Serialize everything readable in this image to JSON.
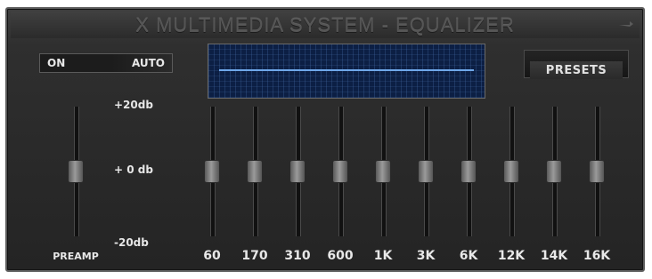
{
  "window": {
    "title": "X MULTIMEDIA SYSTEM - EQUALIZER",
    "close_icon": "close-icon"
  },
  "controls": {
    "on_label": "ON",
    "auto_label": "AUTO",
    "presets_label": "PRESETS"
  },
  "scale": {
    "top": "+20db",
    "mid": "+ 0 db",
    "bottom": "-20db"
  },
  "preamp": {
    "label": "PREAMP",
    "level_db": 0
  },
  "bands": [
    {
      "label": "60",
      "level_db": 0
    },
    {
      "label": "170",
      "level_db": 0
    },
    {
      "label": "310",
      "level_db": 0
    },
    {
      "label": "600",
      "level_db": 0
    },
    {
      "label": "1K",
      "level_db": 0
    },
    {
      "label": "3K",
      "level_db": 0
    },
    {
      "label": "6K",
      "level_db": 0
    },
    {
      "label": "12K",
      "level_db": 0
    },
    {
      "label": "14K",
      "level_db": 0
    },
    {
      "label": "16K",
      "level_db": 0
    }
  ],
  "colors": {
    "display_background": "#0c1f44",
    "display_curve": "#6fa8ea"
  }
}
